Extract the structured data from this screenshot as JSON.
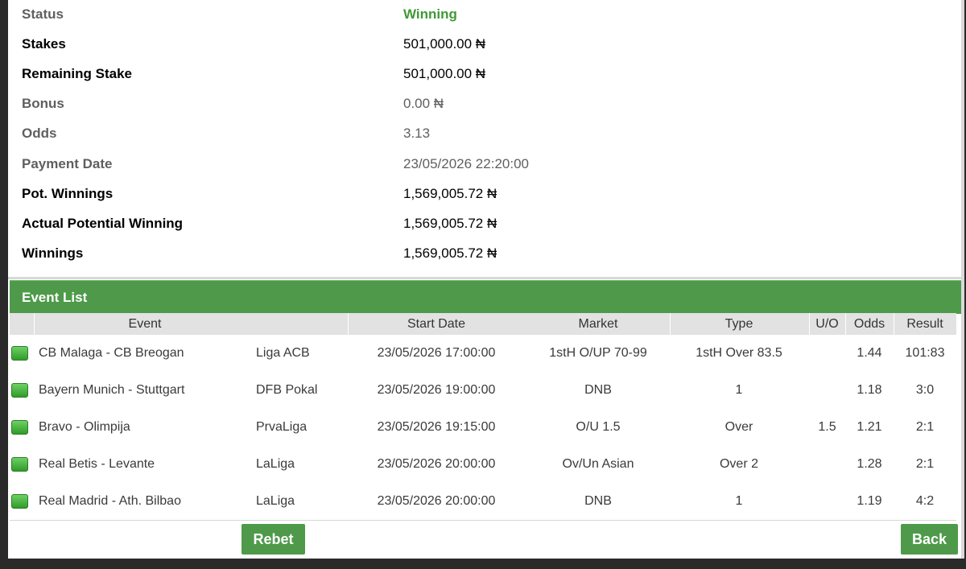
{
  "details": [
    {
      "label": "Status",
      "value": "Winning"
    },
    {
      "label": "Stakes",
      "value": "501,000.00 ₦"
    },
    {
      "label": "Remaining Stake",
      "value": "501,000.00 ₦"
    },
    {
      "label": "Bonus",
      "value": "0.00 ₦"
    },
    {
      "label": "Odds",
      "value": "3.13"
    },
    {
      "label": "Payment Date",
      "value": "23/05/2026 22:20:00"
    },
    {
      "label": "Pot. Winnings",
      "value": "1,569,005.72 ₦"
    },
    {
      "label": "Actual Potential Winning",
      "value": "1,569,005.72 ₦"
    },
    {
      "label": "Winnings",
      "value": "1,569,005.72 ₦"
    }
  ],
  "event_list": {
    "title": "Event List",
    "columns": {
      "event": "Event",
      "start_date": "Start Date",
      "market": "Market",
      "type": "Type",
      "uo": "U/O",
      "odds": "Odds",
      "result": "Result"
    },
    "rows": [
      {
        "event": "CB Malaga - CB Breogan",
        "league": "Liga ACB",
        "start_date": "23/05/2026 17:00:00",
        "market": "1stH O/UP 70-99",
        "type": "1stH Over 83.5",
        "uo": "",
        "odds": "1.44",
        "result": "101:83"
      },
      {
        "event": "Bayern Munich - Stuttgart",
        "league": "DFB Pokal",
        "start_date": "23/05/2026 19:00:00",
        "market": "DNB",
        "type": "1",
        "uo": "",
        "odds": "1.18",
        "result": "3:0"
      },
      {
        "event": "Bravo - Olimpija",
        "league": "PrvaLiga",
        "start_date": "23/05/2026 19:15:00",
        "market": "O/U 1.5",
        "type": "Over",
        "uo": "1.5",
        "odds": "1.21",
        "result": "2:1"
      },
      {
        "event": "Real Betis - Levante",
        "league": "LaLiga",
        "start_date": "23/05/2026 20:00:00",
        "market": "Ov/Un Asian",
        "type": "Over 2",
        "uo": "",
        "odds": "1.28",
        "result": "2:1"
      },
      {
        "event": "Real Madrid - Ath. Bilbao",
        "league": "LaLiga",
        "start_date": "23/05/2026 20:00:00",
        "market": "DNB",
        "type": "1",
        "uo": "",
        "odds": "1.19",
        "result": "4:2"
      }
    ]
  },
  "buttons": {
    "rebet": "Rebet",
    "back": "Back"
  },
  "colors": {
    "accent_green": "#4e9a4a",
    "status_green": "#3f9a36"
  }
}
